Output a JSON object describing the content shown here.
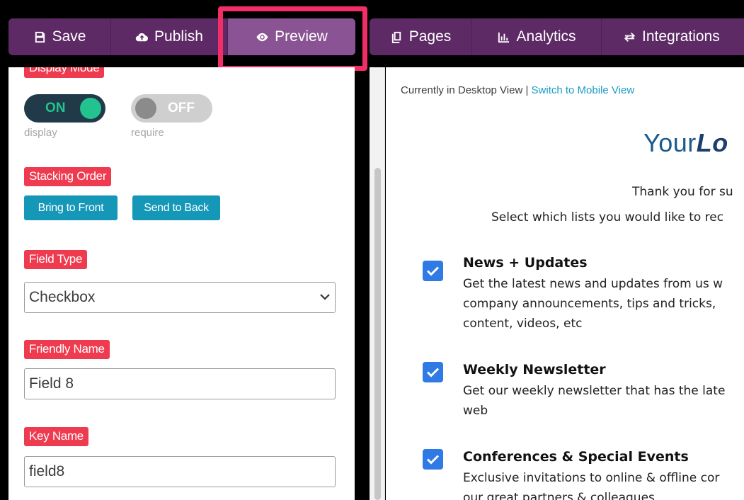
{
  "toolbar": {
    "left": [
      {
        "label": "Save",
        "icon": "save-icon"
      },
      {
        "label": "Publish",
        "icon": "cloud-upload-icon"
      },
      {
        "label": "Preview",
        "icon": "eye-icon",
        "active": true
      }
    ],
    "right": [
      {
        "label": "Pages",
        "icon": "pages-icon"
      },
      {
        "label": "Analytics",
        "icon": "bar-chart-icon"
      },
      {
        "label": "Integrations",
        "icon": "integrations-icon"
      }
    ]
  },
  "panel": {
    "display_mode_label": "Display Mode",
    "toggle_display": {
      "state": "ON",
      "hint": "display"
    },
    "toggle_require": {
      "state": "OFF",
      "hint": "require"
    },
    "stacking_order_label": "Stacking Order",
    "bring_to_front": "Bring to Front",
    "send_to_back": "Send to Back",
    "field_type_label": "Field Type",
    "field_type_value": "Checkbox",
    "friendly_name_label": "Friendly Name",
    "friendly_name_value": "Field 8",
    "key_name_label": "Key Name",
    "key_name_value": "field8"
  },
  "preview": {
    "view_status": "Currently in Desktop View |",
    "switch_link": "Switch to Mobile View",
    "logo_light": "Your",
    "logo_bold": "Lo",
    "thank_you": "Thank you for su",
    "select_lists": "Select which lists you would like to rec",
    "options": [
      {
        "title": "News + Updates",
        "lines": [
          "Get the latest news and updates from us w",
          "company announcements, tips and tricks,",
          "content, videos, etc"
        ],
        "checked": true
      },
      {
        "title": "Weekly Newsletter",
        "lines": [
          "Get our weekly newsletter that has the late",
          "web"
        ],
        "checked": true
      },
      {
        "title": "Conferences & Special Events",
        "lines": [
          "Exclusive invitations to online & offline cor",
          "our great partners & colleagues"
        ],
        "checked": true
      }
    ]
  },
  "colors": {
    "toolbar_bg": "#5e2a66",
    "toolbar_active": "#8a5393",
    "highlight": "#f22e66",
    "tag_bg": "#ef3b50",
    "button_blue": "#1597b8",
    "toggle_green": "#22c38e",
    "checkbox_blue": "#2f7ae5"
  }
}
